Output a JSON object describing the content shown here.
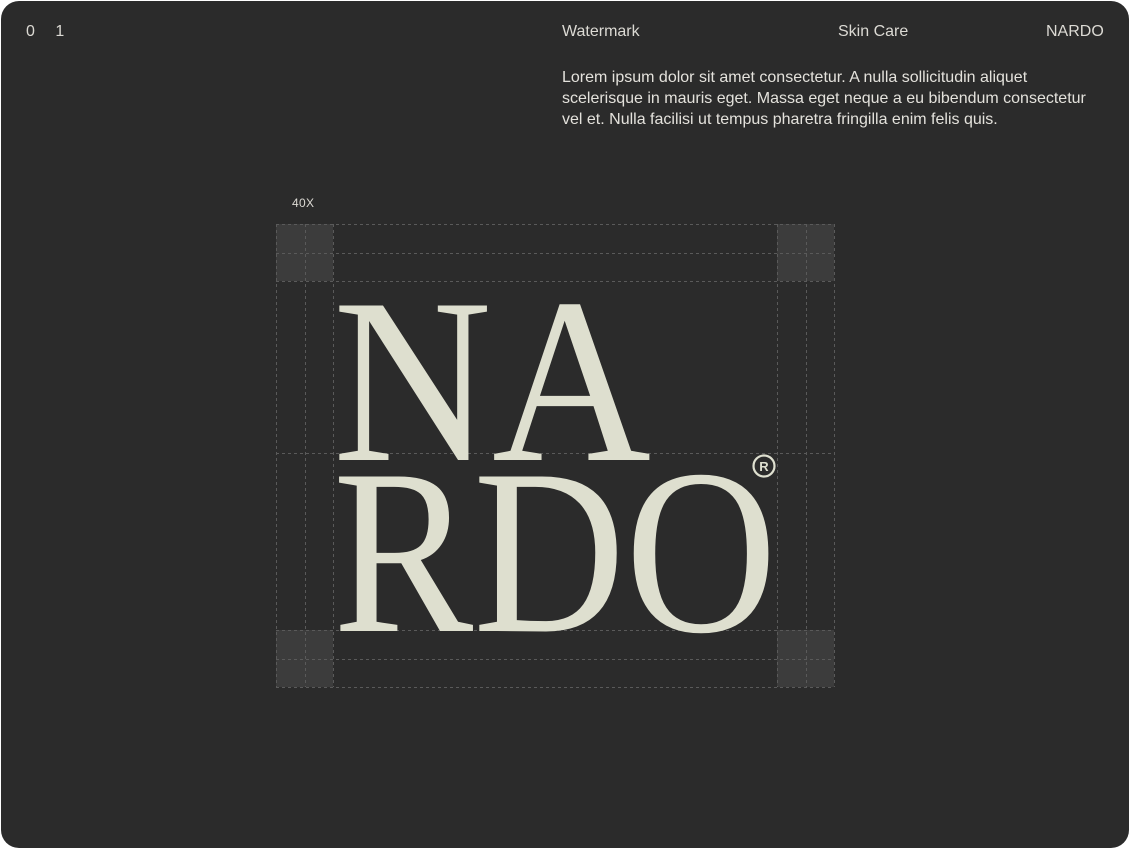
{
  "header": {
    "page_number": "0 1",
    "section": "Watermark",
    "category": "Skin Care",
    "brand": "NARDO"
  },
  "description": "Lorem ipsum dolor sit amet consectetur. A nulla sollicitudin aliquet scelerisque in mauris eget. Massa eget neque a eu bibendum consectetur vel et. Nulla facilisi ut tempus pharetra fringilla enim felis quis.",
  "construction": {
    "scale_label": "40X"
  },
  "logo": {
    "line1": "NA",
    "line2": "RDO",
    "registered": "®",
    "color": "#dedfcf"
  },
  "colors": {
    "background": "#2b2b2b",
    "text": "#dcdad4",
    "guide": "#555555",
    "corner_block": "#3c3c3c"
  }
}
